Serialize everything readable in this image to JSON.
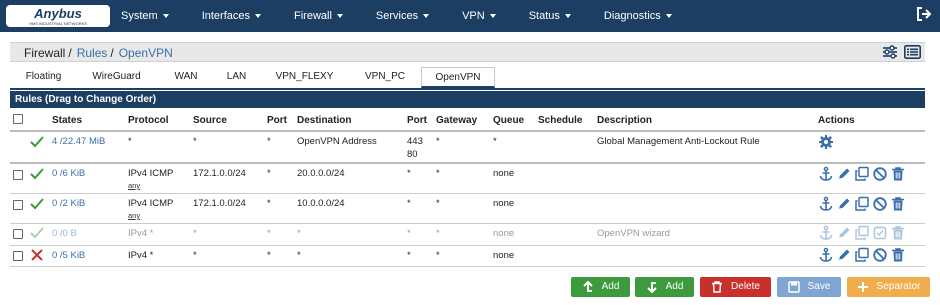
{
  "brand": {
    "name": "Anybus",
    "tagline": "HMS INDUSTRIAL NETWORKS"
  },
  "nav": [
    {
      "label": "System"
    },
    {
      "label": "Interfaces"
    },
    {
      "label": "Firewall"
    },
    {
      "label": "Services"
    },
    {
      "label": "VPN"
    },
    {
      "label": "Status"
    },
    {
      "label": "Diagnostics"
    }
  ],
  "breadcrumb": {
    "root": "Firewall",
    "sep1": "/",
    "rules": "Rules",
    "sep2": "/",
    "current": "OpenVPN"
  },
  "tabs": [
    "Floating",
    "WireGuard",
    "WAN",
    "LAN",
    "VPN_FLEXY",
    "VPN_PC",
    "OpenVPN"
  ],
  "active_tab": "OpenVPN",
  "panel_title": "Rules (Drag to Change Order)",
  "columns": {
    "states": "States",
    "protocol": "Protocol",
    "source": "Source",
    "port": "Port",
    "destination": "Destination",
    "dport": "Port",
    "gateway": "Gateway",
    "queue": "Queue",
    "schedule": "Schedule",
    "description": "Description",
    "actions": "Actions"
  },
  "rows": [
    {
      "states": "4 /22.47 MiB",
      "protocol": "*",
      "protocol_sub": "",
      "source": "*",
      "port": "*",
      "destination": "OpenVPN Address",
      "dport": "443",
      "dport2": "80",
      "gateway": "*",
      "queue": "*",
      "schedule": "",
      "description": "Global Management Anti-Lockout Rule",
      "status": "pass",
      "disabled": false
    },
    {
      "states": "0 /6 KiB",
      "protocol": "IPv4 ICMP",
      "protocol_sub": "any",
      "source": "172.1.0.0/24",
      "port": "*",
      "destination": "20.0.0.0/24",
      "dport": "*",
      "dport2": "",
      "gateway": "*",
      "queue": "none",
      "schedule": "",
      "description": "",
      "status": "pass",
      "disabled": false
    },
    {
      "states": "0 /2 KiB",
      "protocol": "IPv4 ICMP",
      "protocol_sub": "any",
      "source": "172.1.0.0/24",
      "port": "*",
      "destination": "10.0.0.0/24",
      "dport": "*",
      "dport2": "",
      "gateway": "*",
      "queue": "none",
      "schedule": "",
      "description": "",
      "status": "pass",
      "disabled": false
    },
    {
      "states": "0 /0 B",
      "protocol": "IPv4 *",
      "protocol_sub": "",
      "source": "*",
      "port": "*",
      "destination": "*",
      "dport": "*",
      "dport2": "",
      "gateway": "*",
      "queue": "none",
      "schedule": "",
      "description": "OpenVPN wizard",
      "status": "pass",
      "disabled": true
    },
    {
      "states": "0 /5 KiB",
      "protocol": "IPv4 *",
      "protocol_sub": "",
      "source": "*",
      "port": "*",
      "destination": "*",
      "dport": "*",
      "dport2": "",
      "gateway": "*",
      "queue": "none",
      "schedule": "",
      "description": "",
      "status": "block",
      "disabled": false
    }
  ],
  "buttons": [
    {
      "label": "Add",
      "icon": "arrow-up-icon",
      "color": "#3d9a3d"
    },
    {
      "label": "Add",
      "icon": "arrow-down-icon",
      "color": "#3d9a3d"
    },
    {
      "label": "Delete",
      "icon": "trash-icon",
      "color": "#c9302c"
    },
    {
      "label": "Save",
      "icon": "save-icon",
      "color": "#7fa6d2"
    },
    {
      "label": "Separator",
      "icon": "plus-icon",
      "color": "#f0ad4e"
    }
  ],
  "colors": {
    "navbar": "#1c3e63",
    "link": "#3a6fad",
    "pass": "#3d9a3d",
    "block": "#c9302c"
  }
}
